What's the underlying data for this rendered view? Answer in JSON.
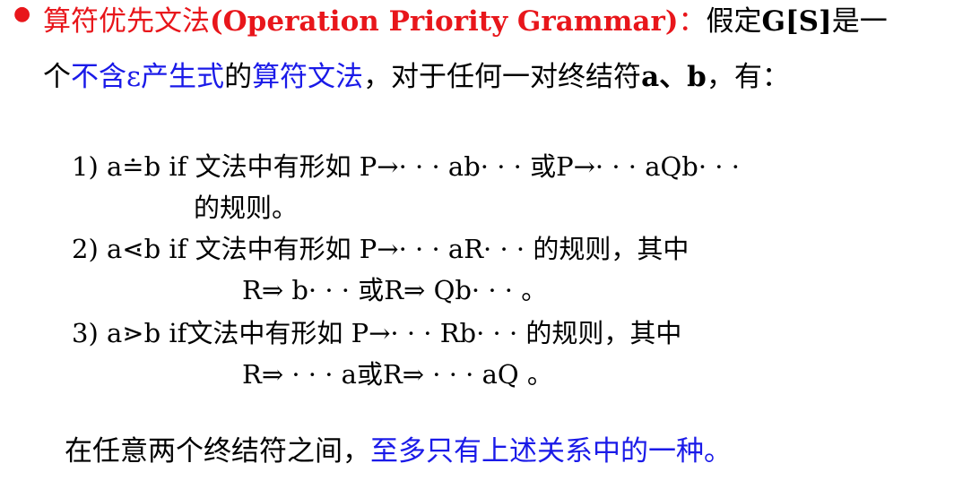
{
  "colors": {
    "red": "#e8161b",
    "blue": "#1a1ae8",
    "black": "#000000"
  },
  "definition": {
    "bullet_icon": "filled-circle-bullet",
    "bullet": "●",
    "term_cn": "算符优先文法",
    "term_en": "(Operation Priority Grammar)",
    "colon": "：",
    "assume": "假定",
    "grammar_symbol": "G[S]",
    "is_a": "是一",
    "line2_a": "个",
    "no_epsilon": "不含ε产生式",
    "line2_b": "的",
    "op_grammar": "算符文法",
    "line2_c": "，对于任何一对终结符",
    "terminals": "a、b",
    "line2_d": "，有："
  },
  "rules": [
    {
      "line1": "1) a≐b    if  文法中有形如 P→· · · ab· · · 或P→· · · aQb· · ·",
      "line2": "的规则。"
    },
    {
      "line1": "2) a⋖b    if 文法中有形如 P→· · · aR· · · 的规则，其中",
      "line2": "R⇒ b· · · 或R⇒ Qb· · ·  。"
    },
    {
      "line1": "3) a⋗b    if文法中有形如 P→· · · Rb· · · 的规则，其中",
      "line2": "R⇒ · · · a或R⇒ · · · aQ 。"
    }
  ],
  "conclusion": {
    "prefix": "在任意两个终结符之间，",
    "highlight": "至多只有上述关系中的一种。"
  }
}
